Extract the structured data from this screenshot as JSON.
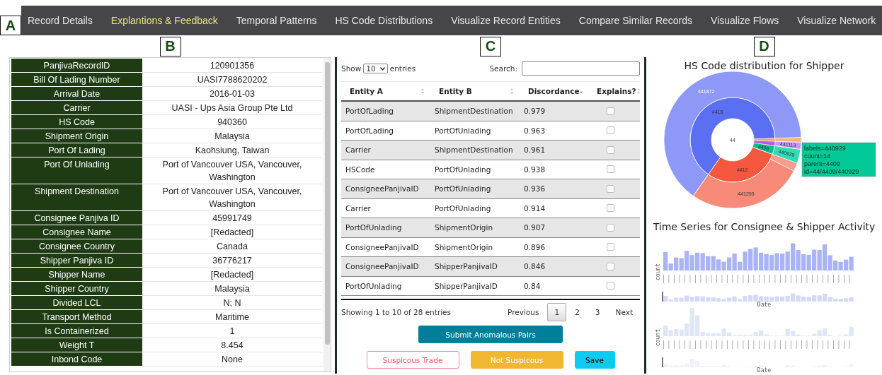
{
  "panel_markers": [
    "A",
    "B",
    "C",
    "D"
  ],
  "nav": [
    {
      "label": "Record Details",
      "selected": false
    },
    {
      "label": "Explantions & Feedback",
      "selected": true
    },
    {
      "label": "Temporal Patterns",
      "selected": false
    },
    {
      "label": "HS Code Distributions",
      "selected": false
    },
    {
      "label": "Visualize Record Entities",
      "selected": false
    },
    {
      "label": "Compare Similar Records",
      "selected": false
    },
    {
      "label": "Visualize Flows",
      "selected": false
    },
    {
      "label": "Visualize Network",
      "selected": false
    }
  ],
  "record": [
    {
      "field": "PanjivaRecordID",
      "value": "120901356"
    },
    {
      "field": "Bill Of Lading Number",
      "value": "UASI7788620202"
    },
    {
      "field": "Arrival Date",
      "value": "2016-01-03"
    },
    {
      "field": "Carrier",
      "value": "UASI - Ups Asia Group Pte Ltd"
    },
    {
      "field": "HS Code",
      "value": "940360"
    },
    {
      "field": "Shipment Origin",
      "value": "Malaysia"
    },
    {
      "field": "Port Of Lading",
      "value": "Kaohsiung, Taiwan"
    },
    {
      "field": "Port Of Unlading",
      "value": "Port of Vancouver USA, Vancouver, Washington"
    },
    {
      "field": "Shipment Destination",
      "value": "Port of Vancouver USA, Vancouver, Washington"
    },
    {
      "field": "Consignee Panjiva ID",
      "value": "45991749"
    },
    {
      "field": "Consignee Name",
      "value": "[Redacted]"
    },
    {
      "field": "Consignee Country",
      "value": "Canada"
    },
    {
      "field": "Shipper Panjiva ID",
      "value": "36776217"
    },
    {
      "field": "Shipper Name",
      "value": "[Redacted]"
    },
    {
      "field": "Shipper Country",
      "value": "Malaysia"
    },
    {
      "field": "Divided LCL",
      "value": "N; N"
    },
    {
      "field": "Transport Method",
      "value": "Maritime"
    },
    {
      "field": "Is Containerized",
      "value": "1"
    },
    {
      "field": "Weight T",
      "value": "8.454"
    },
    {
      "field": "Inbond Code",
      "value": "None"
    }
  ],
  "pairs": {
    "show_label": "Show",
    "page_size": "10",
    "entries_label": "entries",
    "search_label": "Search:",
    "columns": [
      {
        "label": "Entity A",
        "sorted": false
      },
      {
        "label": "Entity B",
        "sorted": false
      },
      {
        "label": "Discordance",
        "sorted": true
      },
      {
        "label": "Explains?",
        "sorted": false
      }
    ],
    "rows": [
      {
        "entity_a": "PortOfLading",
        "entity_b": "ShipmentDestination",
        "discordance": "0.979",
        "explains": false
      },
      {
        "entity_a": "PortOfLading",
        "entity_b": "PortOfUnlading",
        "discordance": "0.963",
        "explains": false
      },
      {
        "entity_a": "Carrier",
        "entity_b": "ShipmentDestination",
        "discordance": "0.961",
        "explains": false
      },
      {
        "entity_a": "HSCode",
        "entity_b": "PortOfUnlading",
        "discordance": "0.938",
        "explains": false
      },
      {
        "entity_a": "ConsigneePanjivaID",
        "entity_b": "PortOfUnlading",
        "discordance": "0.936",
        "explains": false
      },
      {
        "entity_a": "Carrier",
        "entity_b": "PortOfUnlading",
        "discordance": "0.914",
        "explains": false
      },
      {
        "entity_a": "PortOfUnlading",
        "entity_b": "ShipmentOrigin",
        "discordance": "0.907",
        "explains": false
      },
      {
        "entity_a": "ConsigneePanjivaID",
        "entity_b": "ShipmentOrigin",
        "discordance": "0.896",
        "explains": false
      },
      {
        "entity_a": "ConsigneePanjivaID",
        "entity_b": "ShipperPanjivaID",
        "discordance": "0.846",
        "explains": false
      },
      {
        "entity_a": "PortOfUnlading",
        "entity_b": "ShipperPanjivaID",
        "discordance": "0.84",
        "explains": false
      }
    ],
    "info": "Showing 1 to 10 of 28 entries",
    "pagination": [
      {
        "label": "Previous",
        "selected": false
      },
      {
        "label": "1",
        "selected": true
      },
      {
        "label": "2",
        "selected": false
      },
      {
        "label": "3",
        "selected": false
      },
      {
        "label": "Next",
        "selected": false
      }
    ],
    "submit": "Submit Anomalous Pairs",
    "actions": [
      {
        "label": "Suspicous Trade",
        "kind": "outline"
      },
      {
        "label": "Not Suspicous",
        "kind": "warning"
      },
      {
        "label": "Save",
        "kind": "info"
      }
    ]
  },
  "charts": {
    "sunburst_title": "HS Code distribution for Shipper",
    "center_label": "44",
    "segments": [
      {
        "label": "4418",
        "color": "#5b6ff2"
      },
      {
        "label": "4412",
        "color": "#f5573f"
      },
      {
        "label": "4409",
        "color": "#12b88e"
      },
      {
        "label": "441872",
        "color": "#8e98f6"
      },
      {
        "label": "441299",
        "color": "#f88a79"
      },
      {
        "label": "440929",
        "color": "#2fdcb3"
      },
      {
        "label": "441113",
        "color": "#c896f6"
      }
    ],
    "tooltip": [
      "labels=440929",
      "count=14",
      "parent=4409",
      "id=44/4409/440929"
    ],
    "timeseries_title": "Time Series for Consignee & Shipper Activity",
    "ylabels": [
      "count",
      "count"
    ],
    "xlabels": [
      "Date",
      "Date"
    ]
  }
}
